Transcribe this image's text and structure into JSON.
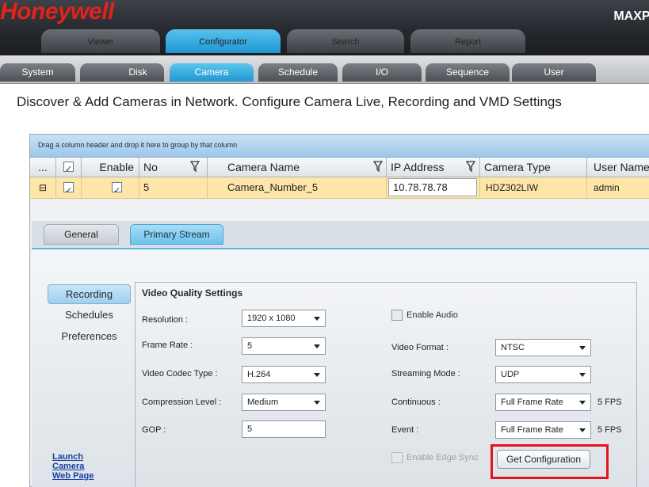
{
  "brand": "Honeywell",
  "product": "MAXPI",
  "main_tabs": [
    {
      "label": "Viewer",
      "active": false
    },
    {
      "label": "Configurator",
      "active": true
    },
    {
      "label": "Search",
      "active": false
    },
    {
      "label": "Report",
      "active": false
    }
  ],
  "sub_tabs": [
    {
      "label": "System",
      "active": false
    },
    {
      "label": "Disk",
      "active": false
    },
    {
      "label": "Camera",
      "active": true
    },
    {
      "label": "Schedule",
      "active": false
    },
    {
      "label": "I/O",
      "active": false
    },
    {
      "label": "Sequence",
      "active": false
    },
    {
      "label": "User",
      "active": false
    }
  ],
  "heading": "Discover & Add Cameras in Network. Configure Camera Live, Recording and VMD Settings",
  "grid": {
    "group_hint": "Drag a column header and drop it here to group by that column",
    "headers": {
      "more": "...",
      "enable": "Enable",
      "no": "No",
      "camera_name": "Camera Name",
      "ip_address": "IP Address",
      "camera_type": "Camera Type",
      "user_name": "User Name"
    },
    "row": {
      "expand": "⊟",
      "no": "5",
      "camera_name": "Camera_Number_5",
      "ip_address": "10.78.78.78",
      "camera_type": "HDZ302LIW",
      "user_name": "admin"
    }
  },
  "detail_tabs": [
    {
      "label": "General",
      "active": false
    },
    {
      "label": "Primary Stream",
      "active": true
    }
  ],
  "side_menu": [
    {
      "label": "Recording",
      "active": true
    },
    {
      "label": "Schedules",
      "active": false
    },
    {
      "label": "Preferences",
      "active": false
    }
  ],
  "launch_link": [
    "Launch",
    "Camera",
    "Web Page"
  ],
  "video_quality": {
    "title": "Video Quality Settings",
    "resolution_label": "Resolution :",
    "resolution": "1920 x 1080",
    "frame_rate_label": "Frame Rate :",
    "frame_rate": "5",
    "codec_label": "Video Codec Type :",
    "codec": "H.264",
    "compression_label": "Compression Level :",
    "compression": "Medium",
    "gop_label": "GOP :",
    "gop": "5",
    "enable_audio_label": "Enable Audio",
    "video_format_label": "Video Format :",
    "video_format": "NTSC",
    "streaming_mode_label": "Streaming Mode :",
    "streaming_mode": "UDP",
    "continuous_label": "Continuous :",
    "continuous": "Full Frame Rate",
    "continuous_fps": "5 FPS",
    "event_label": "Event :",
    "event": "Full Frame Rate",
    "event_fps": "5 FPS",
    "edge_sync_label": "Enable Edge Sync",
    "get_config_label": "Get Configuration"
  }
}
